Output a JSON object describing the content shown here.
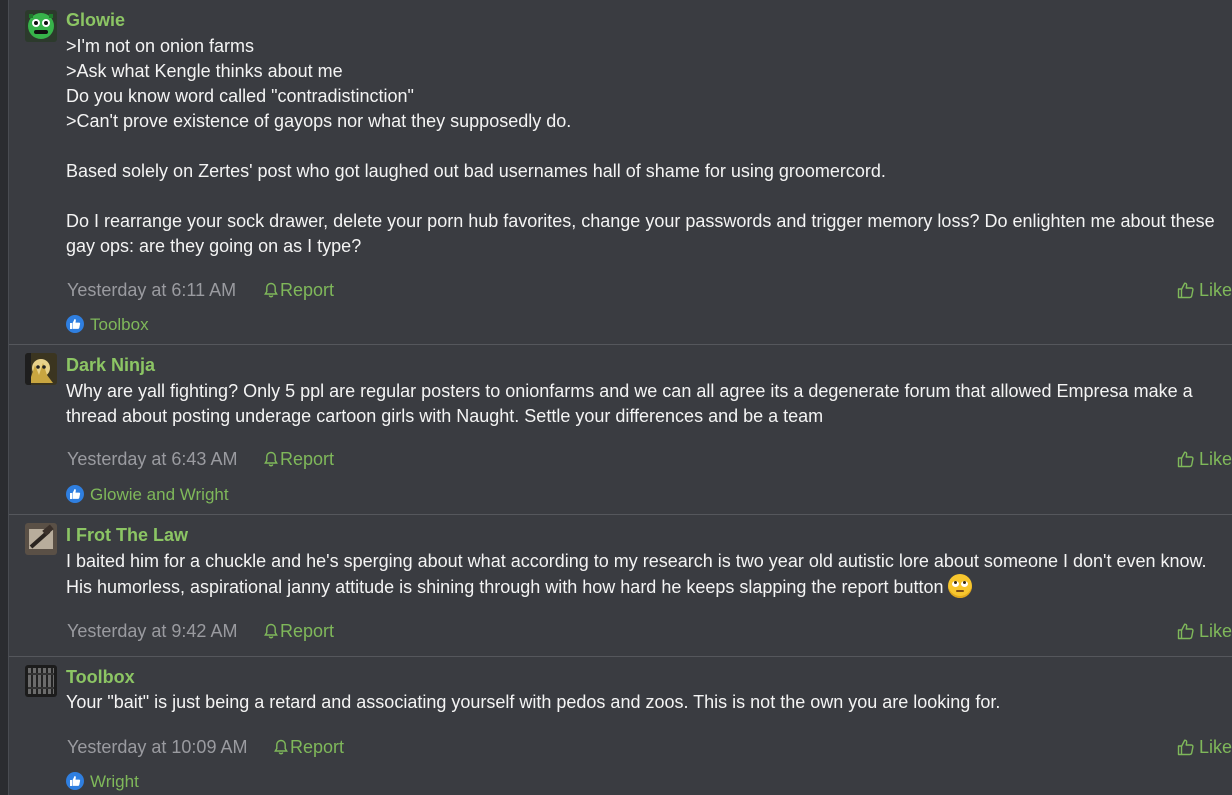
{
  "posts": [
    {
      "username": "Glowie",
      "lines": [
        ">I'm not on onion farms",
        ">Ask what Kengle thinks about me",
        "Do you know word called \"contradistinction\"",
        ">Can't prove existence of gayops nor what they supposedly do.",
        "",
        "Based solely on Zertes' post who got laughed out bad usernames hall of shame for using groomercord.",
        "",
        "Do I rearrange your sock drawer, delete your porn hub favorites, change your passwords and trigger memory loss? Do enlighten me about these gay ops: are they going on as I type?"
      ],
      "time": "Yesterday at 6:11 AM",
      "report": "Report",
      "like": "Like",
      "reactions": "Toolbox"
    },
    {
      "username": "Dark Ninja",
      "lines": [
        "Why are yall fighting? Only 5 ppl are regular posters to onionfarms and we can all agree its a degenerate forum that allowed Empresa make a thread about posting underage cartoon girls with Naught. Settle your differences and be a team"
      ],
      "time": "Yesterday at 6:43 AM",
      "report": "Report",
      "like": "Like",
      "reactions": "Glowie and Wright"
    },
    {
      "username": "I Frot The Law",
      "lines": [
        "I baited him for a chuckle and he's sperging about what according to my research is two year old autistic lore about someone I don't even know. His humorless, aspirational janny attitude is shining through with how hard he keeps slapping the report button"
      ],
      "emoji": "rolling-eyes-emoji",
      "time": "Yesterday at 9:42 AM",
      "report": "Report",
      "like": "Like"
    },
    {
      "username": "Toolbox",
      "lines": [
        "Your \"bait\" is just being a retard and associating yourself with pedos and zoos. This is not the own you are looking for."
      ],
      "time": "Yesterday at 10:09 AM",
      "report": "Report",
      "like": "Like",
      "reactions": "Wright"
    }
  ],
  "colors": {
    "background": "#3a3c41",
    "username": "#8cc564",
    "link": "#7fb85a",
    "meta": "#9a9ba0",
    "reaction_badge": "#2f7fe0"
  }
}
